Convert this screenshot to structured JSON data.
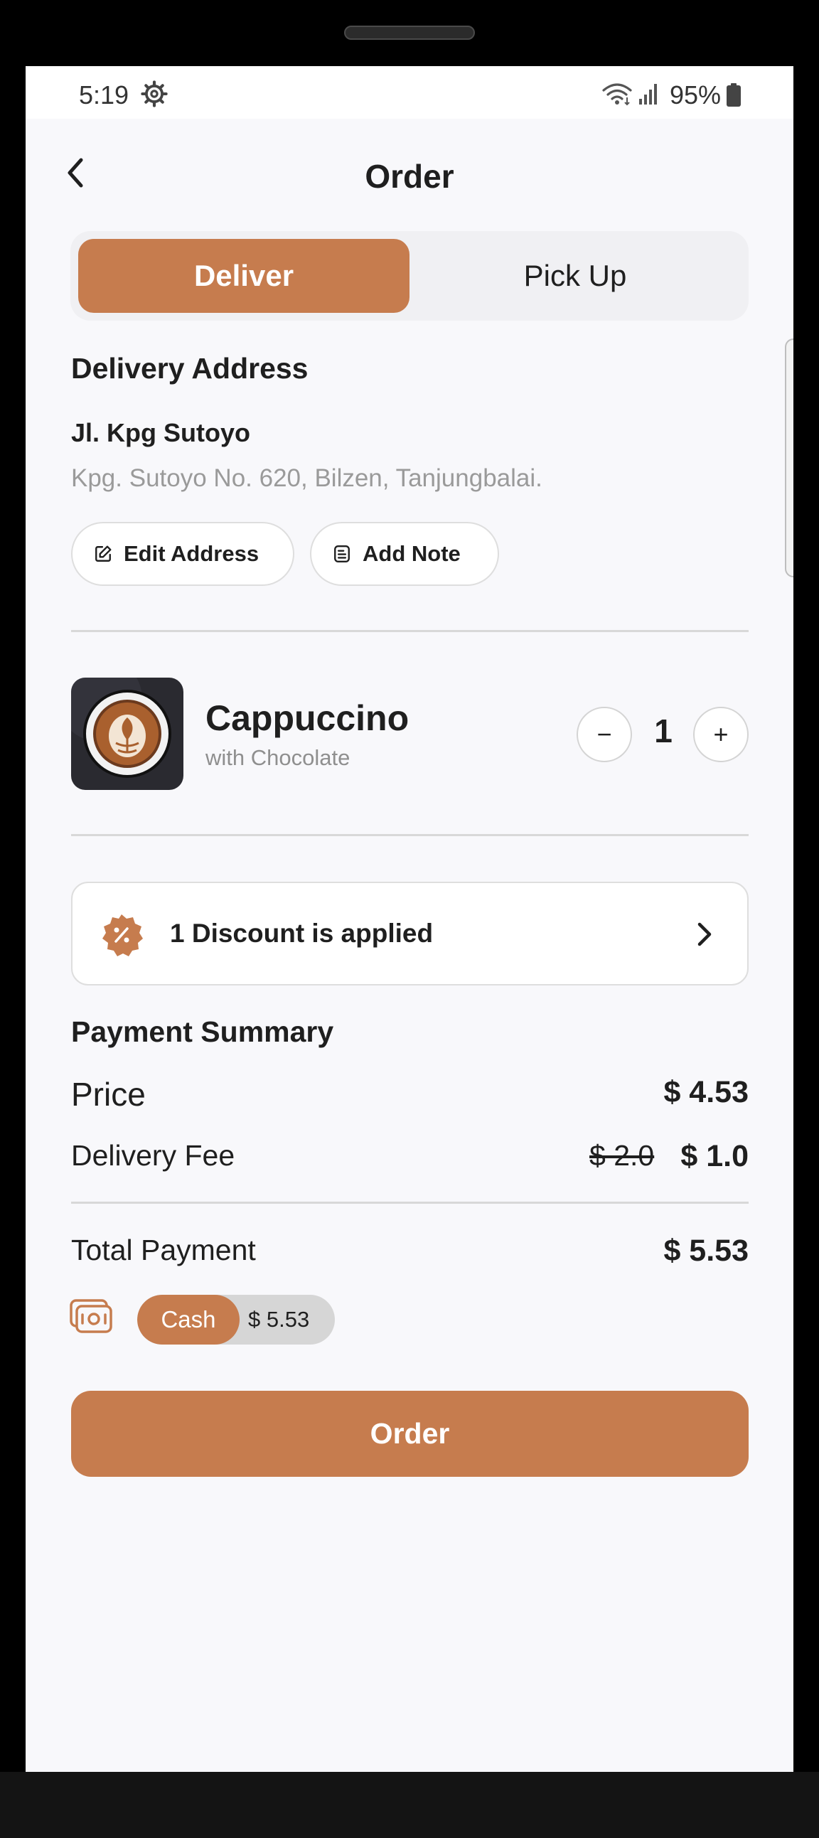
{
  "status_bar": {
    "time": "5:19",
    "battery_percent": "95%",
    "icons": [
      "settings-gear-icon",
      "wifi-icon",
      "signal-icon",
      "battery-icon"
    ]
  },
  "header": {
    "title": "Order",
    "back_icon": "chevron-left-icon"
  },
  "delivery_toggle": {
    "options": [
      "Deliver",
      "Pick Up"
    ],
    "selected": "Deliver"
  },
  "address": {
    "section_title": "Delivery Address",
    "name": "Jl. Kpg Sutoyo",
    "detail": "Kpg. Sutoyo No. 620, Bilzen, Tanjungbalai.",
    "edit_label": "Edit Address",
    "note_label": "Add Note"
  },
  "product": {
    "name": "Cappuccino",
    "variant": "with Chocolate",
    "quantity": "1",
    "minus": "−",
    "plus": "+"
  },
  "discount": {
    "label": "1 Discount is applied"
  },
  "payment_summary": {
    "title": "Payment Summary",
    "price_label": "Price",
    "price_value": "$ 4.53",
    "delivery_label": "Delivery Fee",
    "delivery_original": "$ 2.0",
    "delivery_value": "$ 1.0",
    "total_label": "Total Payment",
    "total_value": "$ 5.53"
  },
  "payment_method": {
    "method": "Cash",
    "amount": "$ 5.53"
  },
  "order_button": {
    "label": "Order"
  },
  "colors": {
    "accent": "#c67c4e",
    "background": "#f8f8fb",
    "text": "#1f1f1f",
    "muted": "#9a9a9a"
  }
}
